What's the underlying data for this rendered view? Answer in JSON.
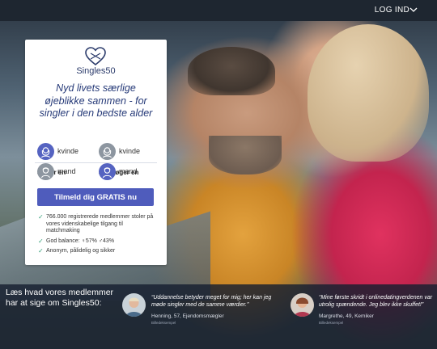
{
  "nav": {
    "login_label": "LOG IND"
  },
  "card": {
    "logo_text": "Singles50",
    "tagline": "Nyd livets særlige øjeblikke sammen - for singler i den bedste alder",
    "i_am_heading": "Jeg er en",
    "seeking_heading": "Jeg søger en",
    "i_am_options": [
      {
        "label": "kvinde",
        "selected": true
      },
      {
        "label": "mand",
        "selected": false
      }
    ],
    "seeking_options": [
      {
        "label": "kvinde",
        "selected": false
      },
      {
        "label": "mand",
        "selected": true
      }
    ],
    "cta_label": "Tilmeld dig GRATIS nu",
    "facts": [
      "766.000 registrerede medlemmer stoler på vores videnskabelige tilgang til matchmaking",
      "God balance: ♀57% ♂43%",
      "Anonym, pålidelig og sikker"
    ]
  },
  "testimonials_section": {
    "heading": "Læs hvad vores medlemmer har at sige om Singles50:",
    "items": [
      {
        "quote": "“Uddannelse betyder meget for mig; her kan jeg møde singler med de samme værdier.”",
        "author": "Henning, 57, Ejendomsmægler",
        "note": "Billedeksempel"
      },
      {
        "quote": "“Mine første skridt i onlinedatingverdenen var utrolig spændende. Jeg blev ikke skuffet!”",
        "author": "Margrethe, 49, Kemiker",
        "note": "Billedeksempel"
      }
    ]
  },
  "colors": {
    "brand_blue": "#4f5cbc",
    "heading_blue": "#263a78",
    "check_green": "#3aa37d",
    "topbar": "#1e2630"
  },
  "icons": {
    "logo": "heart-logo-icon",
    "login": "chevron-down-icon",
    "female": "female-avatar-icon",
    "male": "male-avatar-icon",
    "check": "checkmark-icon"
  }
}
